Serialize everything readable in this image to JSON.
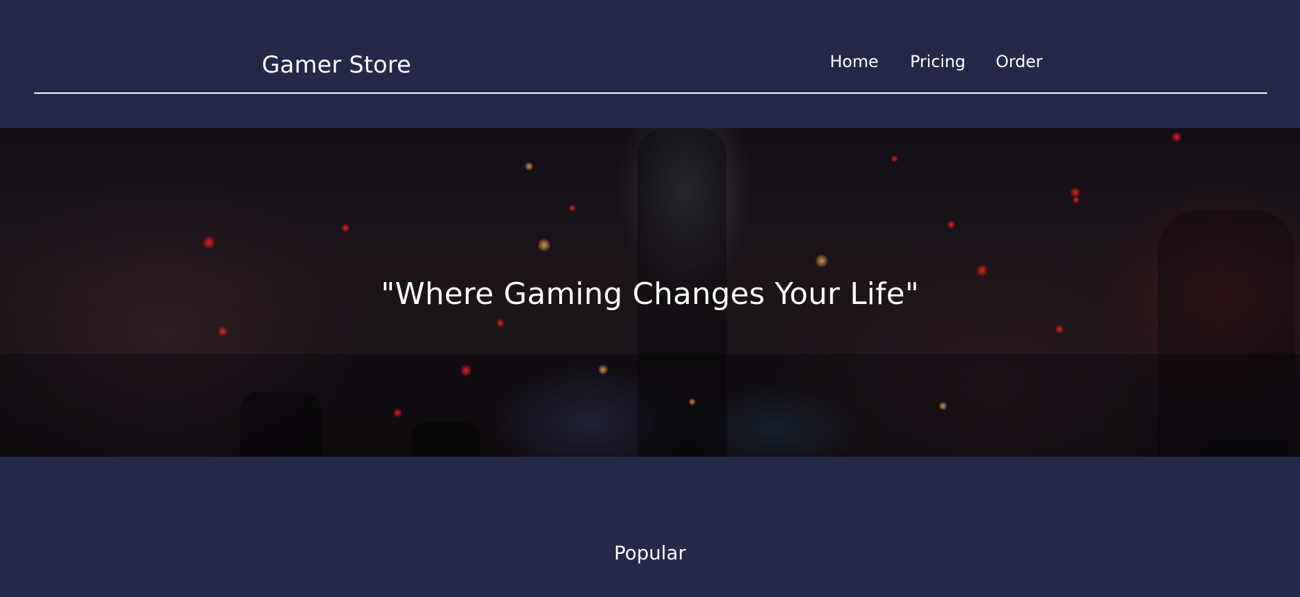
{
  "header": {
    "brand": "Gamer Store",
    "nav": {
      "home": "Home",
      "pricing": "Pricing",
      "order": "Order"
    }
  },
  "hero": {
    "tagline": "\"Where Gaming Changes Your Life\""
  },
  "popular": {
    "title": "Popular"
  },
  "colors": {
    "background": "#252949",
    "text": "#ffffff"
  }
}
